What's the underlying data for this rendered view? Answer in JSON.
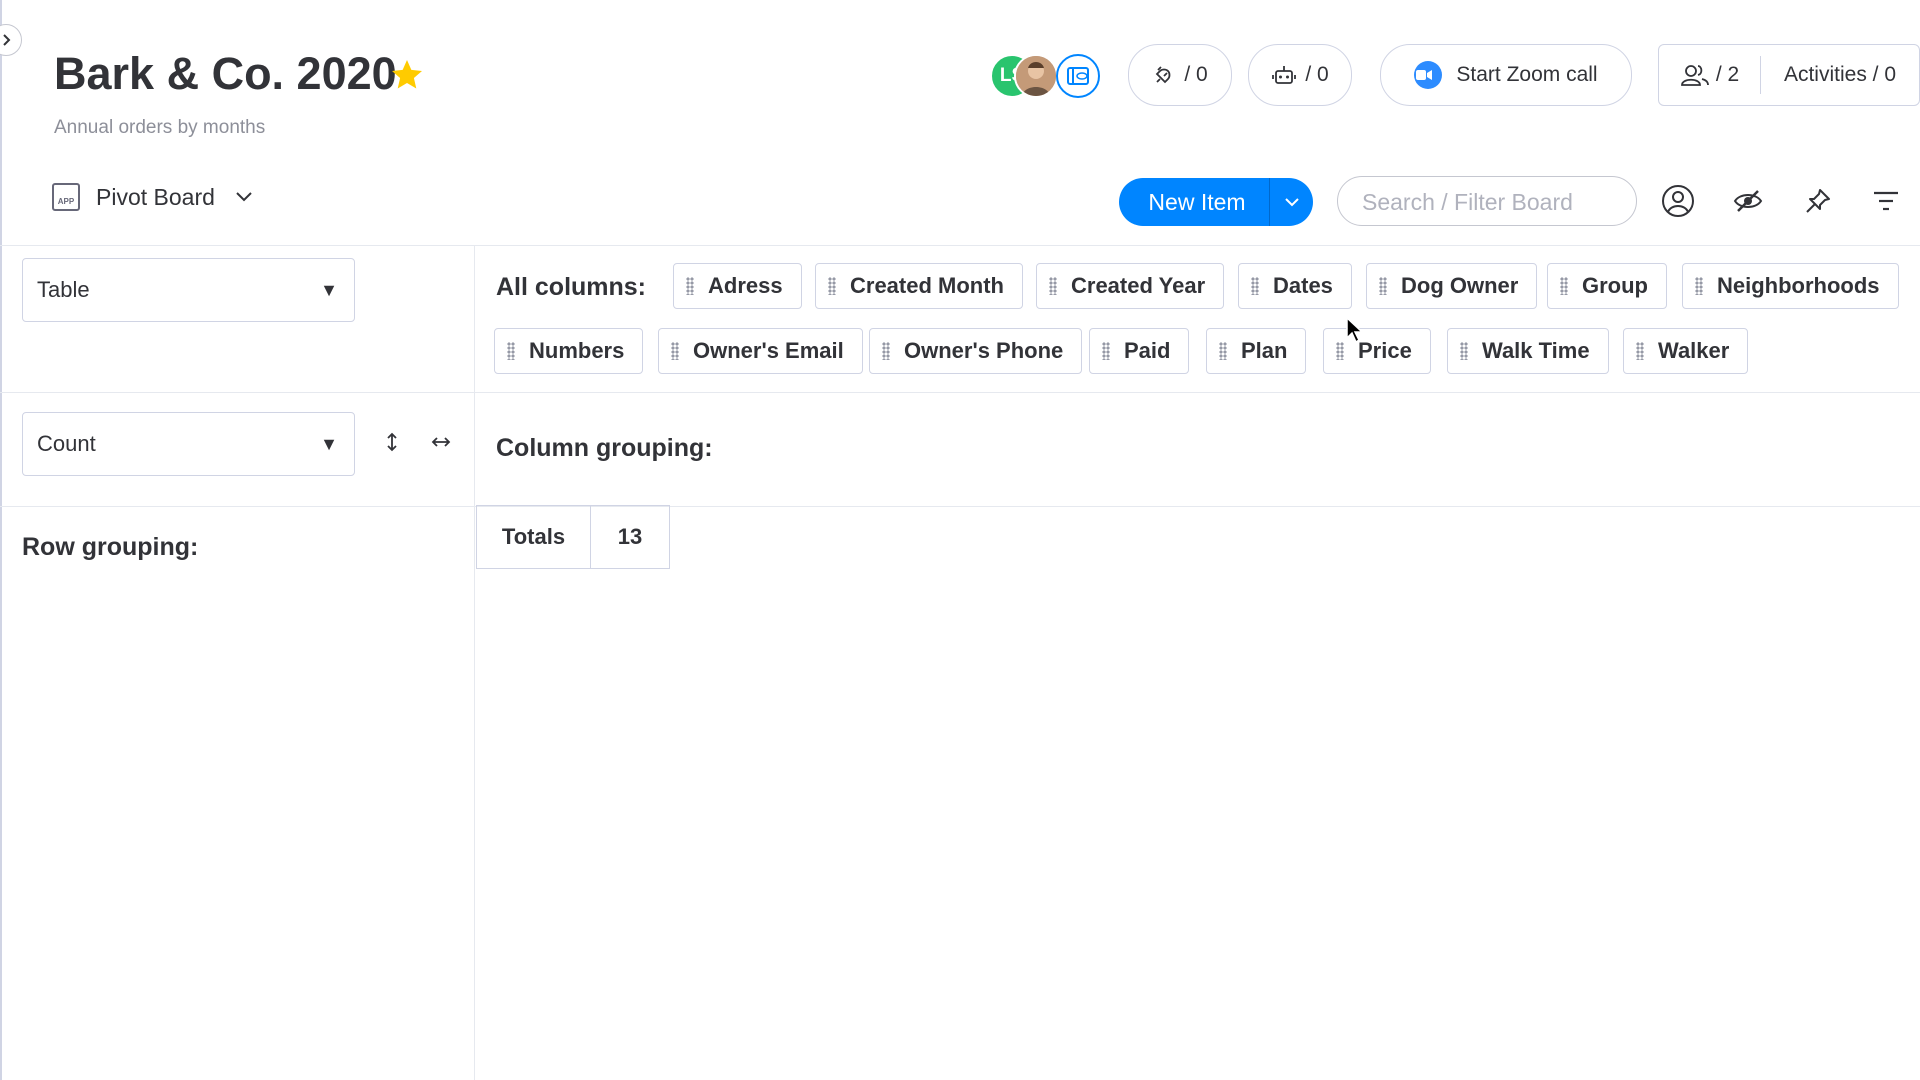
{
  "board": {
    "title": "Bark & Co. 2020",
    "description": "Annual orders by months",
    "star_color": "#ffcb00"
  },
  "header": {
    "avatar_initials": "LS",
    "integrations_count": "/ 0",
    "automations_count": "/ 0",
    "zoom_label": "Start Zoom call",
    "members_count": "/ 2",
    "activities_label": "Activities / 0"
  },
  "toolbar": {
    "view_icon_text": "APP",
    "view_name": "Pivot Board",
    "new_item_label": "New Item",
    "search_placeholder": "Search / Filter Board"
  },
  "pivot": {
    "chart_type_value": "Table",
    "aggregation_value": "Count",
    "all_columns_label": "All columns:",
    "columns": [
      "Adress",
      "Created Month",
      "Created Year",
      "Dates",
      "Dog Owner",
      "Group",
      "Neighborhoods",
      "Numbers",
      "Owner's Email",
      "Owner's Phone",
      "Paid",
      "Plan",
      "Price",
      "Walk Time",
      "Walker"
    ],
    "column_grouping_label": "Column grouping:",
    "row_grouping_label": "Row grouping:",
    "totals_label": "Totals",
    "totals_value": "13"
  },
  "colors": {
    "primary": "#0085ff",
    "green_avatar": "#29c46e",
    "zoom_blue": "#2d8cff",
    "border": "#d0d4e4"
  }
}
